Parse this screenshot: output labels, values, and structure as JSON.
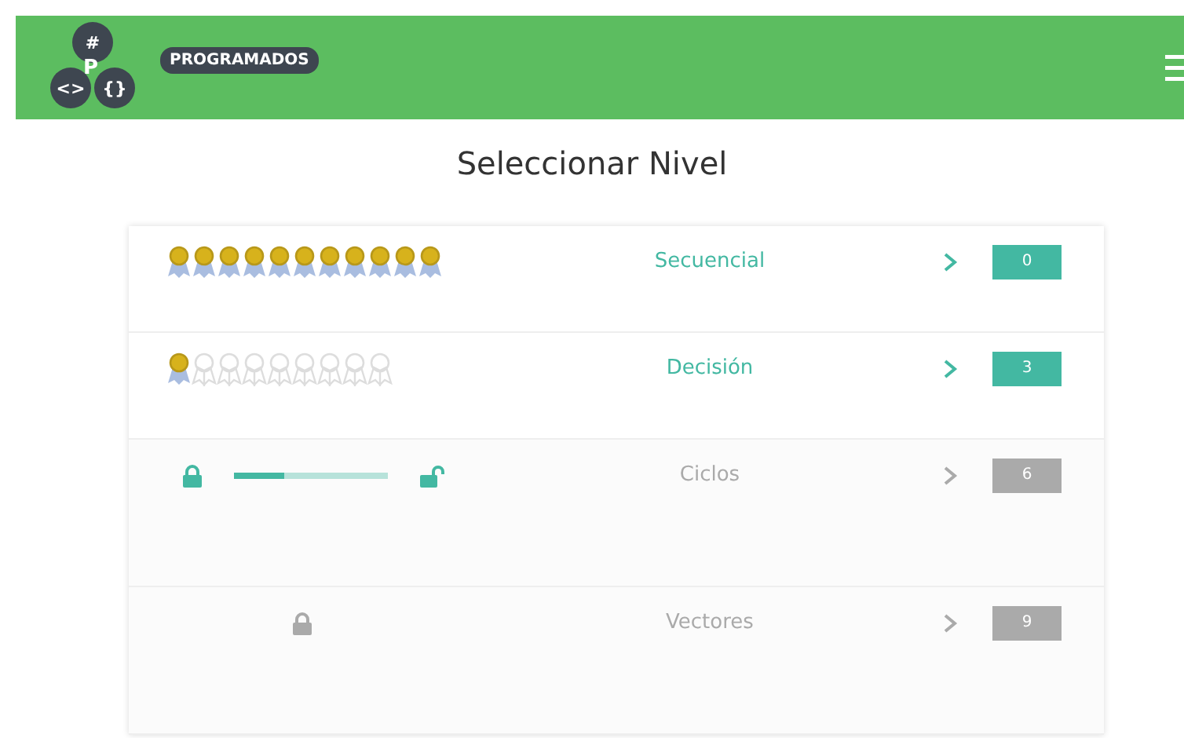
{
  "header": {
    "logo": {
      "top": "#",
      "center": "P",
      "left": "<>",
      "right": "{}"
    },
    "brand": "PROGRAMADOS"
  },
  "title": "Seleccionar Nivel",
  "levels": [
    {
      "kind": "medals",
      "name": "Secuencial",
      "locked": false,
      "count": "0",
      "medals": [
        {
          "earned": true
        },
        {
          "earned": true
        },
        {
          "earned": true
        },
        {
          "earned": true
        },
        {
          "earned": true
        },
        {
          "earned": true
        },
        {
          "earned": true
        },
        {
          "earned": true
        },
        {
          "earned": true
        },
        {
          "earned": true
        },
        {
          "earned": true
        }
      ]
    },
    {
      "kind": "medals",
      "name": "Decisión",
      "locked": false,
      "count": "3",
      "medals": [
        {
          "earned": true
        },
        {
          "earned": false
        },
        {
          "earned": false
        },
        {
          "earned": false
        },
        {
          "earned": false
        },
        {
          "earned": false
        },
        {
          "earned": false
        },
        {
          "earned": false
        },
        {
          "earned": false
        }
      ]
    },
    {
      "kind": "progress",
      "name": "Ciclos",
      "locked": true,
      "count": "6",
      "level": 0.33
    },
    {
      "kind": "locked",
      "name": "Vectores",
      "locked": true,
      "count": "9"
    }
  ]
}
